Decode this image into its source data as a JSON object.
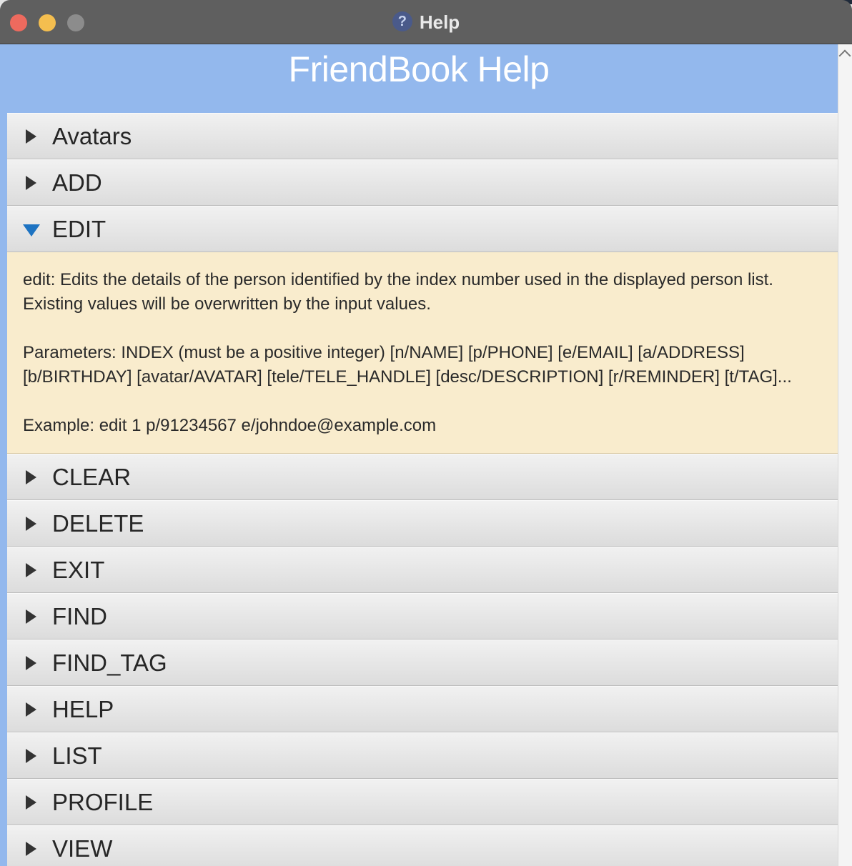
{
  "window": {
    "title": "Help",
    "title_icon": "question-mark-icon"
  },
  "page": {
    "heading": "FriendBook Help"
  },
  "sections": [
    {
      "label": "Avatars",
      "expanded": false
    },
    {
      "label": "ADD",
      "expanded": false
    },
    {
      "label": "EDIT",
      "expanded": true
    },
    {
      "label": "CLEAR",
      "expanded": false
    },
    {
      "label": "DELETE",
      "expanded": false
    },
    {
      "label": "EXIT",
      "expanded": false
    },
    {
      "label": "FIND",
      "expanded": false
    },
    {
      "label": "FIND_TAG",
      "expanded": false
    },
    {
      "label": "HELP",
      "expanded": false
    },
    {
      "label": "LIST",
      "expanded": false
    },
    {
      "label": "PROFILE",
      "expanded": false
    },
    {
      "label": "VIEW",
      "expanded": false
    }
  ],
  "edit_details": {
    "description_line1": "edit: Edits the details of the person identified by the index number used in the displayed person list.",
    "description_line2": "Existing values will be overwritten by the input values.",
    "parameters_line1": "Parameters: INDEX (must be a positive integer) [n/NAME] [p/PHONE] [e/EMAIL] [a/ADDRESS]",
    "parameters_line2": "[b/BIRTHDAY] [avatar/AVATAR] [tele/TELE_HANDLE] [desc/DESCRIPTION] [r/REMINDER] [t/TAG]...",
    "example": "Example: edit 1 p/91234567 e/johndoe@example.com"
  },
  "colors": {
    "header_bg": "#93b8ed",
    "expanded_body_bg": "#f9eccd",
    "expanded_arrow": "#1d73c2"
  }
}
